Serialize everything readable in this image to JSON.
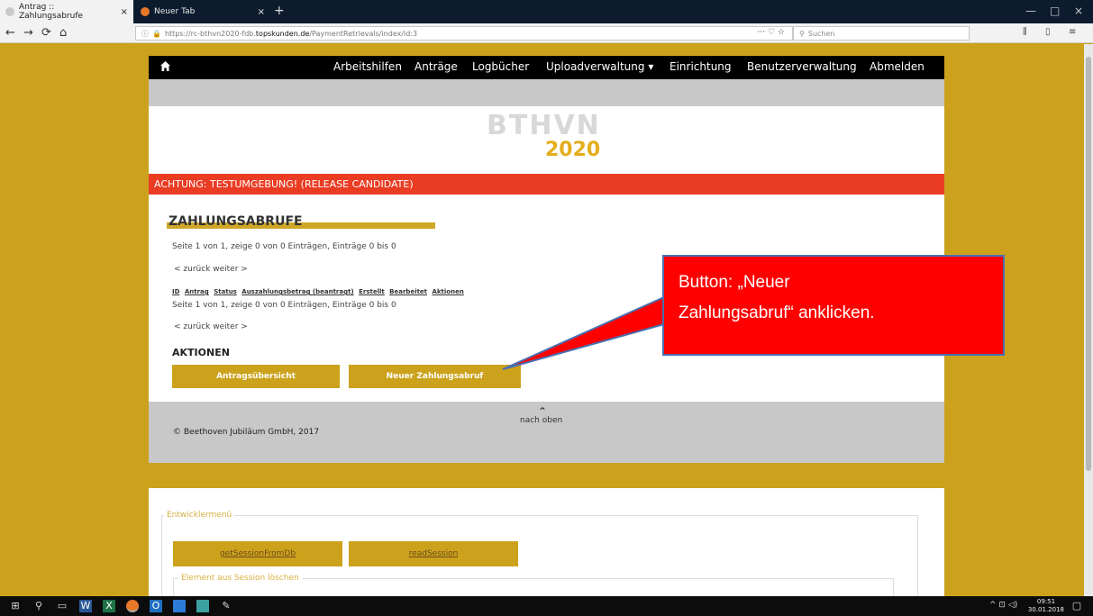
{
  "browser": {
    "tabs": [
      {
        "label": "Antrag :: Zahlungsabrufe",
        "close": "×"
      },
      {
        "label": "Neuer Tab",
        "close": "×"
      }
    ],
    "new_tab": "+",
    "window_controls": {
      "minimize": "—",
      "maximize": "□",
      "close": "×"
    },
    "nav": {
      "back": "←",
      "forward": "→",
      "reload": "⟳",
      "home": "⌂"
    },
    "url": {
      "info": "ⓘ",
      "prefix": "https://rc-bthvn2020-fdb.",
      "domain": "topskunden.de",
      "path": "/PaymentRetrievals/index/id:3",
      "actions": "··· ♡ ☆"
    },
    "search": {
      "icon": "⚲",
      "placeholder": "Suchen"
    },
    "right_icons": {
      "library": "⫼",
      "sidebar": "▯",
      "menu": "≡"
    }
  },
  "site": {
    "home_icon": "home-icon",
    "nav_links": [
      "Arbeitshilfen",
      "Anträge",
      "Logbücher",
      "Uploadverwaltung ▾",
      "Einrichtung",
      "Benutzerverwaltung",
      "Abmelden"
    ],
    "logo_top": "BTHVN",
    "logo_bottom": "2020",
    "warning": "ACHTUNG: TESTUMGEBUNG! (RELEASE CANDIDATE)",
    "warning_color": "#ea3c23",
    "accent_color": "#cca21c"
  },
  "main": {
    "title": "ZAHLUNGSABRUFE",
    "page_info_top": "Seite 1 von 1, zeige 0 von 0 Einträgen, Einträge 0 bis 0",
    "pager_top": "< zurück  weiter >",
    "columns": [
      "ID",
      "Antrag",
      "Status",
      "Auszahlungsbetrag (beantragt)",
      "Erstellt",
      "Bearbeitet",
      "Aktionen"
    ],
    "page_info_bottom": "Seite 1 von 1, zeige 0 von 0 Einträgen, Einträge 0 bis 0",
    "pager_bottom": "< zurück  weiter >",
    "actions_heading": "AKTIONEN",
    "btn_overview": "Antragsübersicht",
    "btn_new": "Neuer Zahlungsabruf"
  },
  "footer": {
    "caret": "⌃",
    "to_top": "nach oben",
    "copyright": "© Beethoven Jubiläum GmbH, 2017"
  },
  "dev": {
    "legend": "Entwicklermenü",
    "btn_get": "getSessionFromDb",
    "btn_read": "readSession",
    "legend2": "Element aus Session löschen"
  },
  "callout": {
    "line1": "Button: „Neuer",
    "line2": "Zahlungsabruf“ anklicken."
  },
  "taskbar": {
    "time": "09:51",
    "date": "30.01.2018"
  }
}
